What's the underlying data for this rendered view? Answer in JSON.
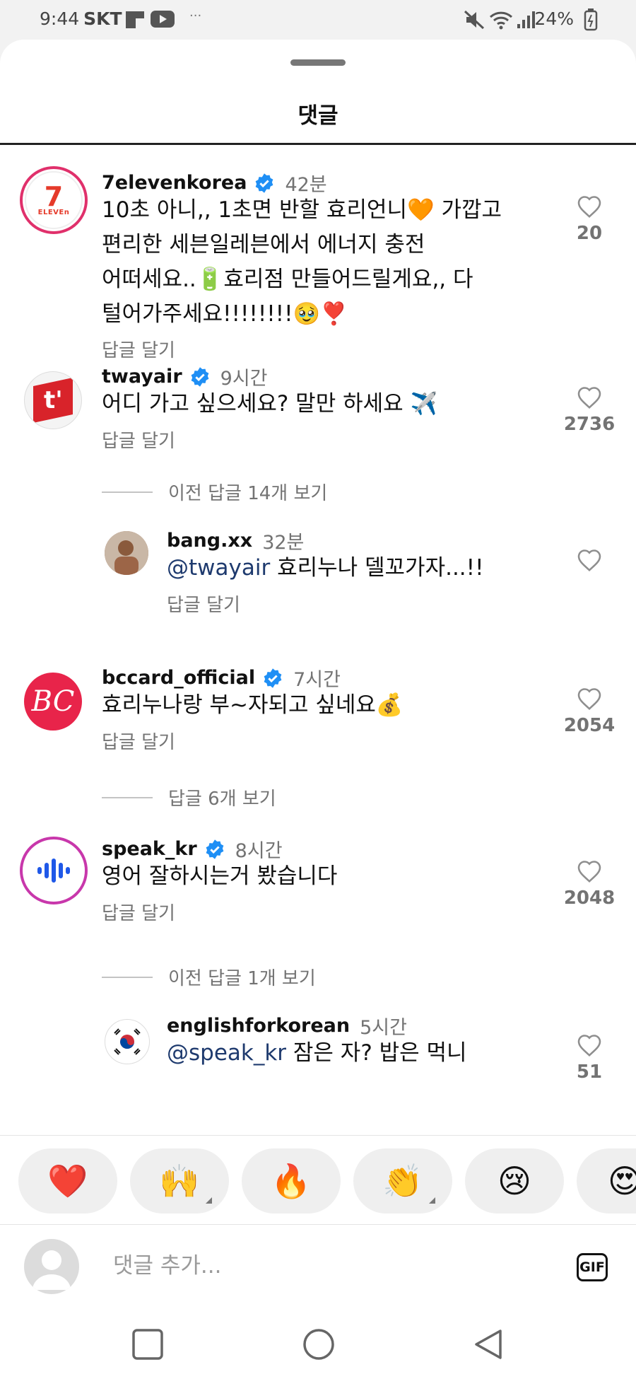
{
  "status_bar": {
    "time": "9:44",
    "carrier": "SKT",
    "dots": "···",
    "battery": "24%"
  },
  "header": {
    "title": "댓글"
  },
  "comments": [
    {
      "username": "7elevenkorea",
      "verified": true,
      "time": "42분",
      "lines": [
        "10초 아니,, 1초면 반할 효리언니🧡 가깝고",
        "편리한 세븐일레븐에서 에너지 충전",
        "어떠세요..🔋효리점 만들어드릴게요,, 다",
        "털어가주세요!!!!!!!!🥹❣️"
      ],
      "reply_label": "답글 달기",
      "likes": "20",
      "avatar_text": "7 ELEVEN"
    },
    {
      "username": "twayair",
      "verified": true,
      "time": "9시간",
      "lines": [
        "어디 가고 싶으세요? 말만 하세요 ✈️"
      ],
      "reply_label": "답글 달기",
      "likes": "2736",
      "avatar_text": "t'"
    },
    {
      "username": "bccard_official",
      "verified": true,
      "time": "7시간",
      "lines": [
        "효리누나랑 부~자되고 싶네요💰"
      ],
      "reply_label": "답글 달기",
      "likes": "2054",
      "avatar_text": "BC"
    },
    {
      "username": "speak_kr",
      "verified": true,
      "time": "8시간",
      "lines": [
        "영어 잘하시는거 봤습니다"
      ],
      "reply_label": "답글 달기",
      "likes": "2048"
    }
  ],
  "replies": [
    {
      "username": "bang.xx",
      "time": "32분",
      "mention": "@twayair",
      "text": " 효리누나 델꼬가자...!!",
      "reply_label": "답글 달기"
    },
    {
      "username": "englishforkorean",
      "time": "5시간",
      "mention": "@speak_kr",
      "text": " 잠은 자? 밥은 먹니",
      "likes": "51"
    }
  ],
  "view_replies": {
    "twayair": "이전 답글 14개 보기",
    "bccard": "답글 6개 보기",
    "speak": "이전 답글 1개 보기"
  },
  "reactions": [
    "❤️",
    "🙌",
    "🔥",
    "👏",
    "😢",
    "😍"
  ],
  "input": {
    "placeholder": "댓글 추가...",
    "gif_label": "GIF"
  },
  "colors": {
    "verified": "#1f8ff5",
    "mention": "#1e3a6e",
    "muted": "#737373"
  }
}
